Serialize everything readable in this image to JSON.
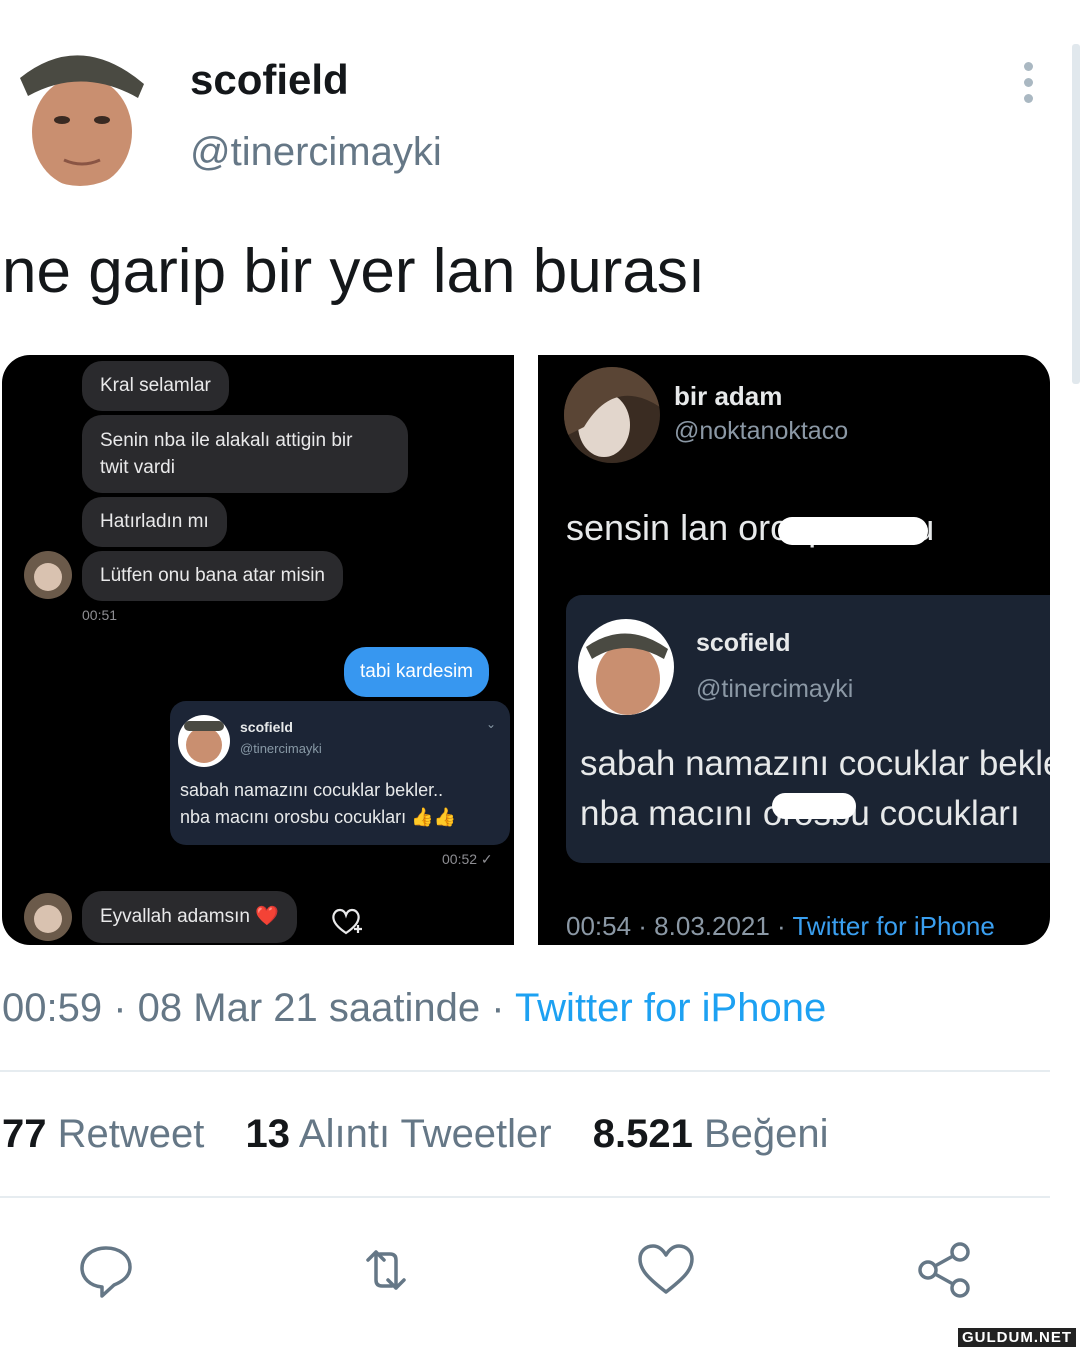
{
  "tweet": {
    "name": "scofield",
    "handle": "@tinercimayki",
    "text": "ne garip bir yer lan burası",
    "time": "00:59",
    "date": "08 Mar 21 saatinde",
    "source": "Twitter for iPhone",
    "separator": " · "
  },
  "dm": {
    "messages_in": [
      "Kral selamlar",
      "Senin nba ile alakalı attigin bir",
      "twit vardi",
      "Hatırladın mı",
      "Lütfen onu bana atar misin"
    ],
    "time_1": "00:51",
    "reply": "tabi kardesim",
    "shared_name": "scofield",
    "shared_handle": "@tinercimayki",
    "shared_line1": "sabah namazını cocuklar bekler..",
    "shared_line2": "nba macını orosbu cocukları 👍👍",
    "time_2": "00:52 ✓",
    "last_message": "Eyvallah adamsın ❤️"
  },
  "reply_tweet": {
    "name": "bir adam",
    "handle": "@noktanoktaco",
    "text": "sensin lan orospu cocu",
    "quoted_name": "scofield",
    "quoted_handle": "@tinercimayki",
    "quoted_line1": "sabah namazını cocuklar bekler..",
    "quoted_line2": "nba macını orosbu cocukları",
    "meta": "00:54 · 8.03.2021 · ",
    "source": "Twitter for iPhone"
  },
  "stats": {
    "retweets": "77",
    "retweets_label": "Retweet",
    "quotes": "13",
    "quotes_label": "Alıntı Tweetler",
    "likes": "8.521",
    "likes_label": "Beğeni"
  },
  "watermark": "GULDUM.NET",
  "colors": {
    "link": "#1da1f2",
    "muted": "#657786",
    "dm_blue": "#3797f0"
  }
}
